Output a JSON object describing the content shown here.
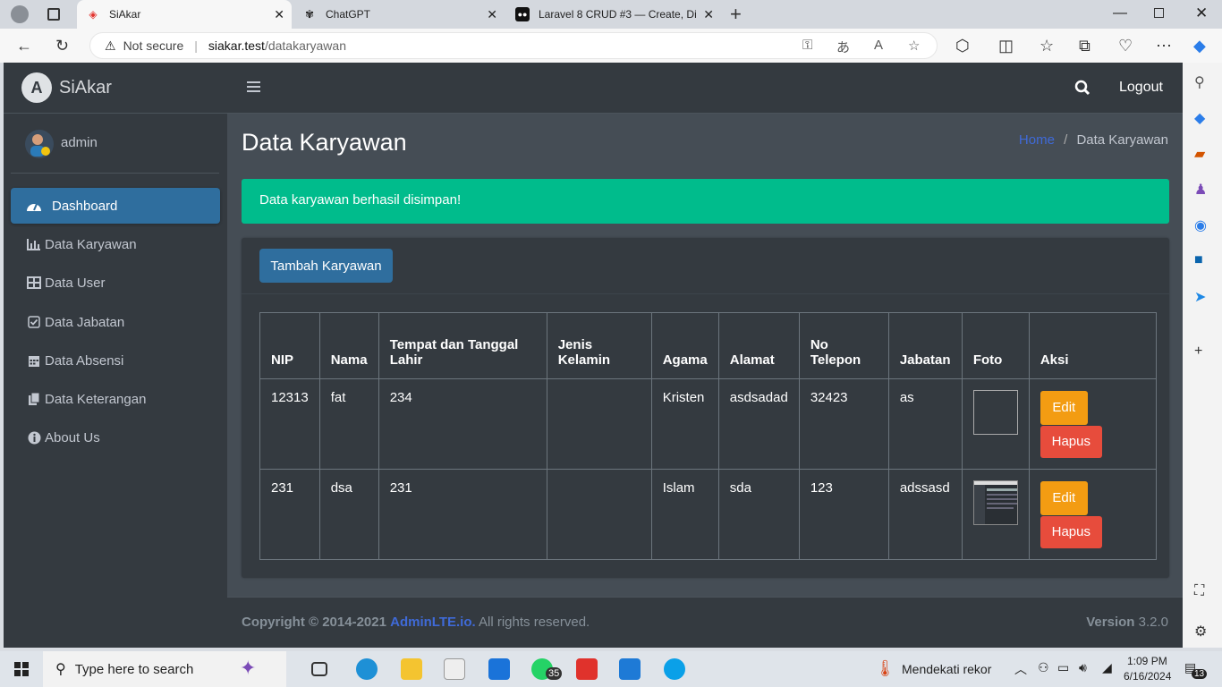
{
  "browser": {
    "tabs": [
      {
        "title": "SiAkar",
        "active": true
      },
      {
        "title": "ChatGPT",
        "active": false
      },
      {
        "title": "Laravel 8 CRUD #3 — Create, Di",
        "active": false
      }
    ],
    "security": "Not secure",
    "url_host": "siakar.test",
    "url_path": "/datakaryawan"
  },
  "brand": {
    "name": "SiAkar"
  },
  "user": {
    "name": "admin"
  },
  "sidebar": {
    "items": [
      {
        "label": "Dashboard",
        "icon": "tachometer-icon",
        "active": true
      },
      {
        "label": "Data Karyawan",
        "icon": "bar-chart-icon",
        "active": false
      },
      {
        "label": "Data User",
        "icon": "table-icon",
        "active": false
      },
      {
        "label": "Data Jabatan",
        "icon": "check-square-icon",
        "active": false
      },
      {
        "label": "Data Absensi",
        "icon": "calendar-icon",
        "active": false
      },
      {
        "label": "Data Keterangan",
        "icon": "copy-icon",
        "active": false
      },
      {
        "label": "About Us",
        "icon": "info-circle-icon",
        "active": false
      }
    ]
  },
  "topnav": {
    "logout": "Logout"
  },
  "page": {
    "title": "Data Karyawan",
    "breadcrumb_home": "Home",
    "breadcrumb_sep": "/",
    "breadcrumb_current": "Data Karyawan"
  },
  "alert": {
    "message": "Data karyawan berhasil disimpan!"
  },
  "card": {
    "add_button": "Tambah Karyawan"
  },
  "table": {
    "headers": [
      "NIP",
      "Nama",
      "Tempat dan Tanggal Lahir",
      "Jenis Kelamin",
      "Agama",
      "Alamat",
      "No Telepon",
      "Jabatan",
      "Foto",
      "Aksi"
    ],
    "rows": [
      {
        "nip": "12313",
        "nama": "fat",
        "ttl": "234",
        "jk": "",
        "agama": "Kristen",
        "alamat": "asdsadad",
        "telepon": "32423",
        "jabatan": "as"
      },
      {
        "nip": "231",
        "nama": "dsa",
        "ttl": "231",
        "jk": "",
        "agama": "Islam",
        "alamat": "sda",
        "telepon": "123",
        "jabatan": "adssasd"
      }
    ],
    "edit_label": "Edit",
    "delete_label": "Hapus"
  },
  "footer": {
    "copyright": "Copyright © 2014-2021",
    "link": "AdminLTE.io.",
    "rights": "All rights reserved.",
    "version_label": "Version",
    "version": "3.2.0"
  },
  "taskbar": {
    "search_placeholder": "Type here to search",
    "weather": "Mendekati rekor",
    "time": "1:09 PM",
    "date": "6/16/2024",
    "whatsapp_badge": "35",
    "notification_count": "13"
  },
  "colors": {
    "sidebar": "#343a40",
    "content": "#454d55",
    "primary": "#2f6e9e",
    "success": "#00bc8c",
    "warning": "#f39c12",
    "danger": "#e74c3c"
  }
}
